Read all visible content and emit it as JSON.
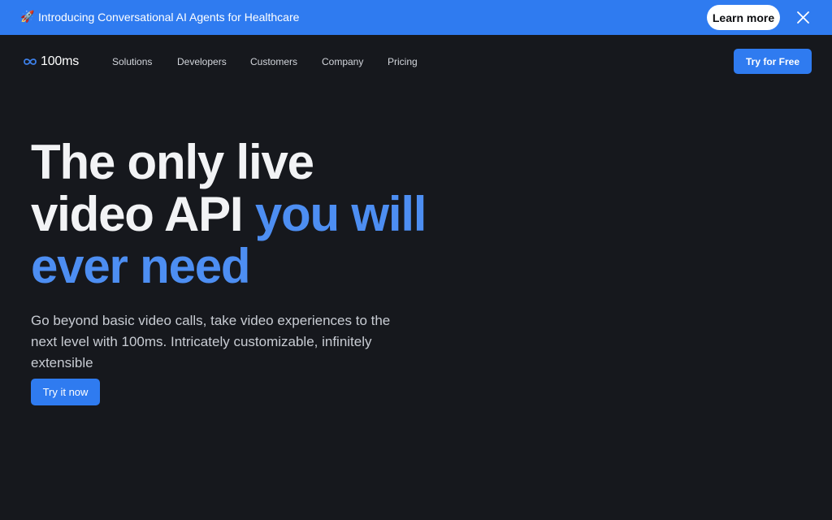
{
  "banner": {
    "icon": "rocket-icon",
    "text": "Introducing Conversational AI Agents for Healthcare",
    "learn_more_label": "Learn more",
    "close_icon": "close-icon"
  },
  "nav": {
    "logo_text": "100ms",
    "links": [
      {
        "label": "Solutions"
      },
      {
        "label": "Developers"
      },
      {
        "label": "Customers"
      },
      {
        "label": "Company"
      },
      {
        "label": "Pricing"
      }
    ],
    "cta_label": "Try for Free"
  },
  "hero": {
    "title_line1": "The only live",
    "title_line2_plain": "video API ",
    "title_line2_accent": "you will",
    "title_line3_accent": "ever need",
    "subtitle": "Go beyond basic video calls, take video experiences to the next level with 100ms. Intricately customizable, infinitely extensible",
    "cta_label": "Try it now"
  },
  "colors": {
    "background": "#16181d",
    "accent": "#2f7bf0",
    "accent_text": "#4d8ef2",
    "banner": "#2f7bf0"
  }
}
